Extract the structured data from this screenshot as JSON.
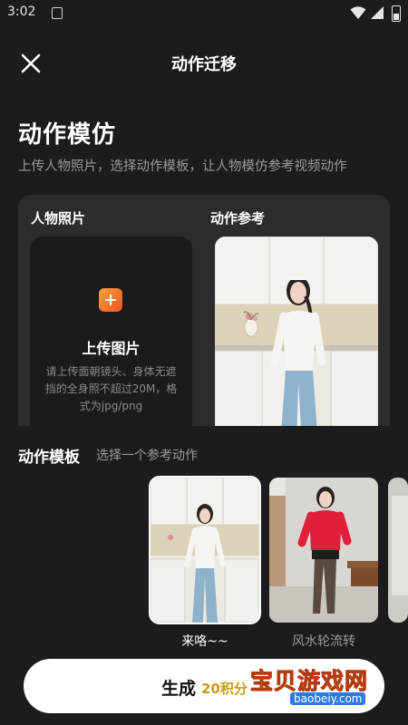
{
  "status": {
    "time": "3:02"
  },
  "header": {
    "title": "动作迁移"
  },
  "intro": {
    "title": "动作模仿",
    "subtitle": "上传人物照片，选择动作模板，让人物模仿参考视频动作"
  },
  "panel": {
    "person_label": "人物照片",
    "reference_label": "动作参考",
    "upload_title": "上传图片",
    "upload_desc": "请上传面朝镜头、身体无遮挡的全身照不超过20M，格式为jpg/png"
  },
  "templates": {
    "title": "动作模板",
    "hint": "选择一个参考动作",
    "items": [
      {
        "label": "来咯~~",
        "selected": true
      },
      {
        "label": "风水轮流转",
        "selected": false
      }
    ]
  },
  "generate": {
    "label": "生成",
    "cost": "20积分"
  },
  "watermark": {
    "title": "宝贝游戏网",
    "url": "baobeiy.com"
  },
  "colors": {
    "accent_orange": "#f08a2c",
    "cost_gold": "#c79b16",
    "red_sweater": "#e0203a"
  }
}
